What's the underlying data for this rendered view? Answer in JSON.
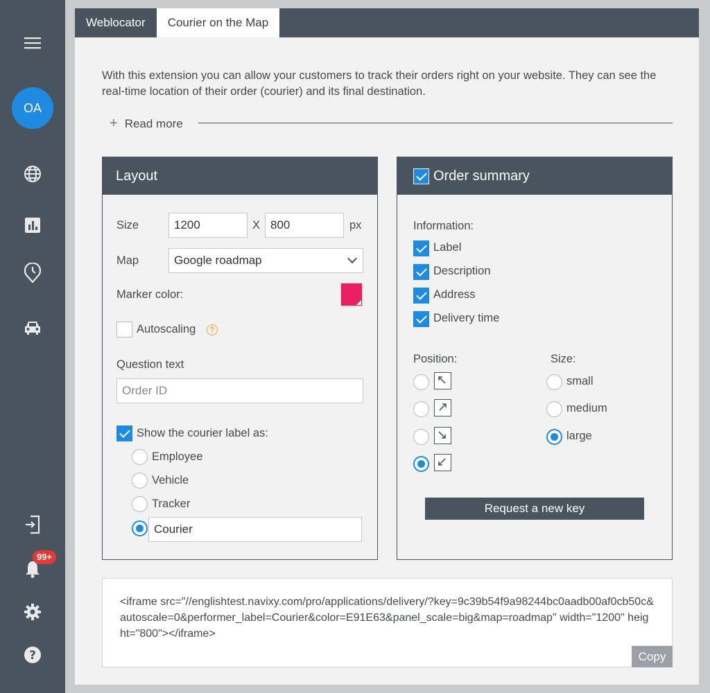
{
  "sidebar": {
    "avatar_initials": "OA",
    "notifications_badge": "99+"
  },
  "tabs": [
    {
      "label": "Weblocator",
      "active": false
    },
    {
      "label": "Courier on the Map",
      "active": true
    }
  ],
  "intro": {
    "text": "With this extension you can allow your customers to track their orders right on your website. They can see the real-time location of their order (courier) and its final destination.",
    "read_more": "Read more"
  },
  "layout": {
    "title": "Layout",
    "size_label": "Size",
    "width": "1200",
    "x_label": "X",
    "height": "800",
    "unit": "px",
    "map_label": "Map",
    "map_value": "Google roadmap",
    "marker_label": "Marker color:",
    "marker_color": "#E91E63",
    "autoscaling_label": "Autoscaling",
    "autoscaling_checked": false,
    "question_label": "Question text",
    "question_placeholder": "Order ID",
    "show_label": "Show the courier label as:",
    "show_checked": true,
    "options": [
      "Employee",
      "Vehicle",
      "Tracker"
    ],
    "custom_value": "Courier",
    "selected": "Courier"
  },
  "summary": {
    "title": "Order summary",
    "enabled": true,
    "info_label": "Information:",
    "info_items": [
      {
        "label": "Label",
        "checked": true
      },
      {
        "label": "Description",
        "checked": true
      },
      {
        "label": "Address",
        "checked": true
      },
      {
        "label": "Delivery time",
        "checked": true
      }
    ],
    "position_label": "Position:",
    "position_selected": "bottom-left",
    "size_label": "Size:",
    "sizes": [
      "small",
      "medium",
      "large"
    ],
    "size_selected": "large",
    "request_button": "Request a new key"
  },
  "embed": {
    "code": "<iframe src=\"//englishtest.navixy.com/pro/applications/delivery/?key=9c39b54f9a98244bc0aadb00af0cb50c&autoscale=0&performer_label=Courier&color=E91E63&panel_scale=big&map=roadmap\" width=\"1200\" height=\"800\"></iframe>",
    "copy_label": "Copy"
  }
}
